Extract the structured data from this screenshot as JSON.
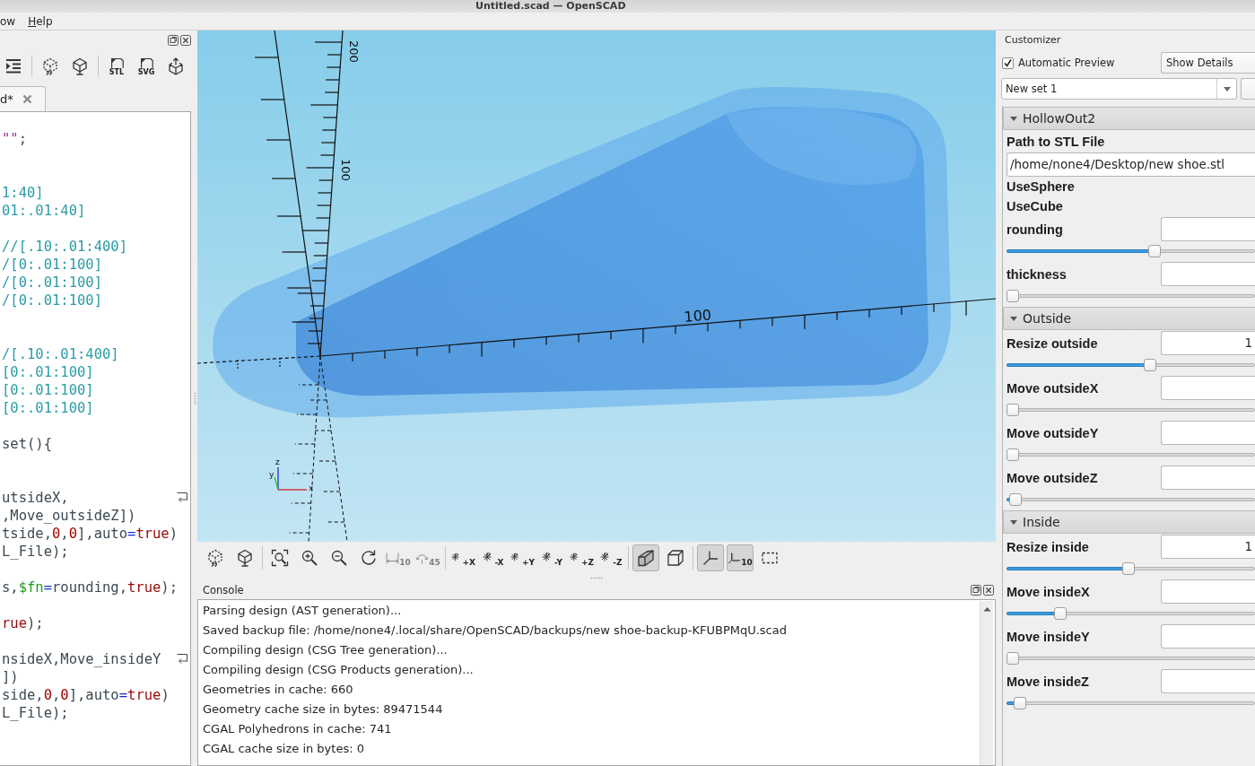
{
  "window": {
    "title": "Untitled.scad — OpenSCAD"
  },
  "menu": [
    {
      "label": "ow",
      "mnemonic": false
    },
    {
      "label": "Help",
      "mnemonic": true
    }
  ],
  "editor": {
    "toolbar": [
      {
        "kind": "indent"
      },
      {
        "kind": "separator"
      },
      {
        "kind": "preview"
      },
      {
        "kind": "render"
      },
      {
        "kind": "separator"
      },
      {
        "kind": "export",
        "label": "STL"
      },
      {
        "kind": "export",
        "label": "SVG"
      },
      {
        "kind": "send"
      }
    ],
    "tabs": [
      {
        "label": "d*",
        "selected": true
      }
    ],
    "lines": [
      {
        "kind": "blank"
      },
      {
        "kind": "code",
        "wrapped": false,
        "tokens": [
          {
            "text": "\"\"",
            "kind": "string"
          },
          {
            "text": ";",
            "kind": "plain"
          }
        ]
      },
      {
        "kind": "blank"
      },
      {
        "kind": "blank"
      },
      {
        "kind": "code",
        "wrapped": false,
        "tokens": [
          {
            "text": "1:40]",
            "kind": "comment"
          }
        ]
      },
      {
        "kind": "code",
        "wrapped": false,
        "tokens": [
          {
            "text": "01:.01:40]",
            "kind": "comment"
          }
        ]
      },
      {
        "kind": "blank"
      },
      {
        "kind": "code",
        "wrapped": false,
        "tokens": [
          {
            "text": "//[.10:.01:400]",
            "kind": "comment"
          }
        ]
      },
      {
        "kind": "code",
        "wrapped": false,
        "tokens": [
          {
            "text": "/[0:.01:100]",
            "kind": "comment"
          }
        ]
      },
      {
        "kind": "code",
        "wrapped": false,
        "tokens": [
          {
            "text": "/[0:.01:100]",
            "kind": "comment"
          }
        ]
      },
      {
        "kind": "code",
        "wrapped": false,
        "tokens": [
          {
            "text": "/[0:.01:100]",
            "kind": "comment"
          }
        ]
      },
      {
        "kind": "blank"
      },
      {
        "kind": "blank"
      },
      {
        "kind": "code",
        "wrapped": false,
        "tokens": [
          {
            "text": "/[.10:.01:400]",
            "kind": "comment"
          }
        ]
      },
      {
        "kind": "code",
        "wrapped": false,
        "tokens": [
          {
            "text": "[0:.01:100]",
            "kind": "comment"
          }
        ]
      },
      {
        "kind": "code",
        "wrapped": false,
        "tokens": [
          {
            "text": "[0:.01:100]",
            "kind": "comment"
          }
        ]
      },
      {
        "kind": "code",
        "wrapped": false,
        "tokens": [
          {
            "text": "[0:.01:100]",
            "kind": "comment"
          }
        ]
      },
      {
        "kind": "blank"
      },
      {
        "kind": "code",
        "wrapped": false,
        "tokens": [
          {
            "text": "set(){",
            "kind": "plain"
          }
        ]
      },
      {
        "kind": "blank"
      },
      {
        "kind": "blank"
      },
      {
        "kind": "code",
        "wrapped": true,
        "tokens": [
          {
            "text": "utsideX,",
            "kind": "plain"
          }
        ]
      },
      {
        "kind": "code",
        "wrapped": false,
        "tokens": [
          {
            "text": ",Move_outsideZ])",
            "kind": "plain"
          }
        ]
      },
      {
        "kind": "code",
        "wrapped": false,
        "tokens": [
          {
            "text": "tside,",
            "kind": "plain"
          },
          {
            "text": "0",
            "kind": "number"
          },
          {
            "text": ",",
            "kind": "plain"
          },
          {
            "text": "0",
            "kind": "number"
          },
          {
            "text": "],auto",
            "kind": "plain"
          },
          {
            "text": "=",
            "kind": "operator"
          },
          {
            "text": "true",
            "kind": "keyword"
          },
          {
            "text": ")",
            "kind": "plain"
          }
        ]
      },
      {
        "kind": "code",
        "wrapped": false,
        "tokens": [
          {
            "text": "L_File);",
            "kind": "plain"
          }
        ]
      },
      {
        "kind": "blank"
      },
      {
        "kind": "code",
        "wrapped": false,
        "tokens": [
          {
            "text": "s,",
            "kind": "plain"
          },
          {
            "text": "$fn",
            "kind": "special"
          },
          {
            "text": "=",
            "kind": "operator"
          },
          {
            "text": "rounding,",
            "kind": "plain"
          },
          {
            "text": "true",
            "kind": "keyword"
          },
          {
            "text": ");",
            "kind": "plain"
          }
        ]
      },
      {
        "kind": "blank"
      },
      {
        "kind": "code",
        "wrapped": false,
        "tokens": [
          {
            "text": "rue",
            "kind": "keyword"
          },
          {
            "text": ");",
            "kind": "plain"
          }
        ]
      },
      {
        "kind": "blank"
      },
      {
        "kind": "code",
        "wrapped": true,
        "tokens": [
          {
            "text": "nsideX,Move_insideY",
            "kind": "plain"
          }
        ]
      },
      {
        "kind": "code",
        "wrapped": false,
        "tokens": [
          {
            "text": "])",
            "kind": "plain"
          }
        ]
      },
      {
        "kind": "code",
        "wrapped": false,
        "tokens": [
          {
            "text": "side,",
            "kind": "plain"
          },
          {
            "text": "0",
            "kind": "number"
          },
          {
            "text": ",",
            "kind": "plain"
          },
          {
            "text": "0",
            "kind": "number"
          },
          {
            "text": "],auto",
            "kind": "plain"
          },
          {
            "text": "=",
            "kind": "operator"
          },
          {
            "text": "true",
            "kind": "keyword"
          },
          {
            "text": ")",
            "kind": "plain"
          }
        ]
      },
      {
        "kind": "code",
        "wrapped": false,
        "tokens": [
          {
            "text": "L_File);",
            "kind": "plain"
          }
        ]
      }
    ]
  },
  "viewport": {
    "y_axis_labels": [
      "200",
      "100"
    ],
    "x_axis_labels": [
      "100"
    ],
    "gizmo_labels": [
      "z",
      "y",
      "x"
    ],
    "toolbar": [
      {
        "kind": "preview",
        "pressed": false,
        "disabled": false
      },
      {
        "kind": "render",
        "pressed": false,
        "disabled": false
      },
      {
        "kind": "separator"
      },
      {
        "kind": "zoom-all",
        "pressed": false,
        "disabled": false
      },
      {
        "kind": "zoom-in",
        "pressed": false,
        "disabled": false
      },
      {
        "kind": "zoom-out",
        "pressed": false,
        "disabled": false
      },
      {
        "kind": "reset-view",
        "pressed": false,
        "disabled": false
      },
      {
        "kind": "measure-distance",
        "label": "10",
        "pressed": false,
        "disabled": true
      },
      {
        "kind": "measure-angle",
        "label": "45",
        "pressed": false,
        "disabled": true
      },
      {
        "kind": "separator"
      },
      {
        "kind": "view",
        "label": "+X",
        "pressed": false,
        "disabled": false
      },
      {
        "kind": "view",
        "label": "-X",
        "pressed": false,
        "disabled": false
      },
      {
        "kind": "view",
        "label": "+Y",
        "pressed": false,
        "disabled": false
      },
      {
        "kind": "view",
        "label": "-Y",
        "pressed": false,
        "disabled": false
      },
      {
        "kind": "view",
        "label": "+Z",
        "pressed": false,
        "disabled": false
      },
      {
        "kind": "view",
        "label": "-Z",
        "pressed": false,
        "disabled": false
      },
      {
        "kind": "separator"
      },
      {
        "kind": "perspective",
        "pressed": true,
        "disabled": false
      },
      {
        "kind": "orthogonal",
        "pressed": false,
        "disabled": false
      },
      {
        "kind": "separator"
      },
      {
        "kind": "axes",
        "pressed": true,
        "disabled": false
      },
      {
        "kind": "scale-markers",
        "label": "10",
        "pressed": true,
        "disabled": false
      },
      {
        "kind": "edges",
        "pressed": false,
        "disabled": false
      }
    ]
  },
  "console": {
    "title": "Console",
    "lines": [
      "Parsing design (AST generation)...",
      "Saved backup file: /home/none4/.local/share/OpenSCAD/backups/new shoe-backup-KFUBPMqU.scad",
      "Compiling design (CSG Tree generation)...",
      "Compiling design (CSG Products generation)...",
      "Geometries in cache: 660",
      "Geometry cache size in bytes: 89471544",
      "CGAL Polyhedrons in cache: 741",
      "CGAL cache size in bytes: 0"
    ]
  },
  "customizer": {
    "title": "Customizer",
    "auto_preview": {
      "label": "Automatic Preview",
      "checked": true
    },
    "details": "Show Details",
    "preset": "New set 1",
    "groups": [
      {
        "name": "HollowOut2",
        "expanded": true,
        "params": [
          {
            "kind": "text",
            "label": "Path to STL File",
            "value": "/home/none4/Desktop/new shoe.stl"
          },
          {
            "kind": "flag",
            "label": "UseSphere"
          },
          {
            "kind": "flag",
            "label": "UseCube"
          },
          {
            "kind": "slider",
            "label": "rounding",
            "level": 0.6
          },
          {
            "kind": "slider",
            "label": "thickness",
            "level": 0
          }
        ]
      },
      {
        "name": "Outside",
        "expanded": true,
        "params": [
          {
            "kind": "slider",
            "label": "Resize outside",
            "value": "1",
            "level": 0.58
          },
          {
            "kind": "slider",
            "label": "Move outsideX",
            "level": 0
          },
          {
            "kind": "slider",
            "label": "Move outsideY",
            "level": 0
          },
          {
            "kind": "slider",
            "label": "Move outsideZ",
            "level": 0.01
          }
        ]
      },
      {
        "name": "Inside",
        "expanded": true,
        "params": [
          {
            "kind": "slider",
            "label": "Resize inside",
            "value": "1",
            "level": 0.49
          },
          {
            "kind": "slider",
            "label": "Move insideX",
            "level": 0.2
          },
          {
            "kind": "slider",
            "label": "Move insideY",
            "level": 0
          },
          {
            "kind": "slider",
            "label": "Move insideZ",
            "level": 0.03
          }
        ]
      }
    ]
  }
}
